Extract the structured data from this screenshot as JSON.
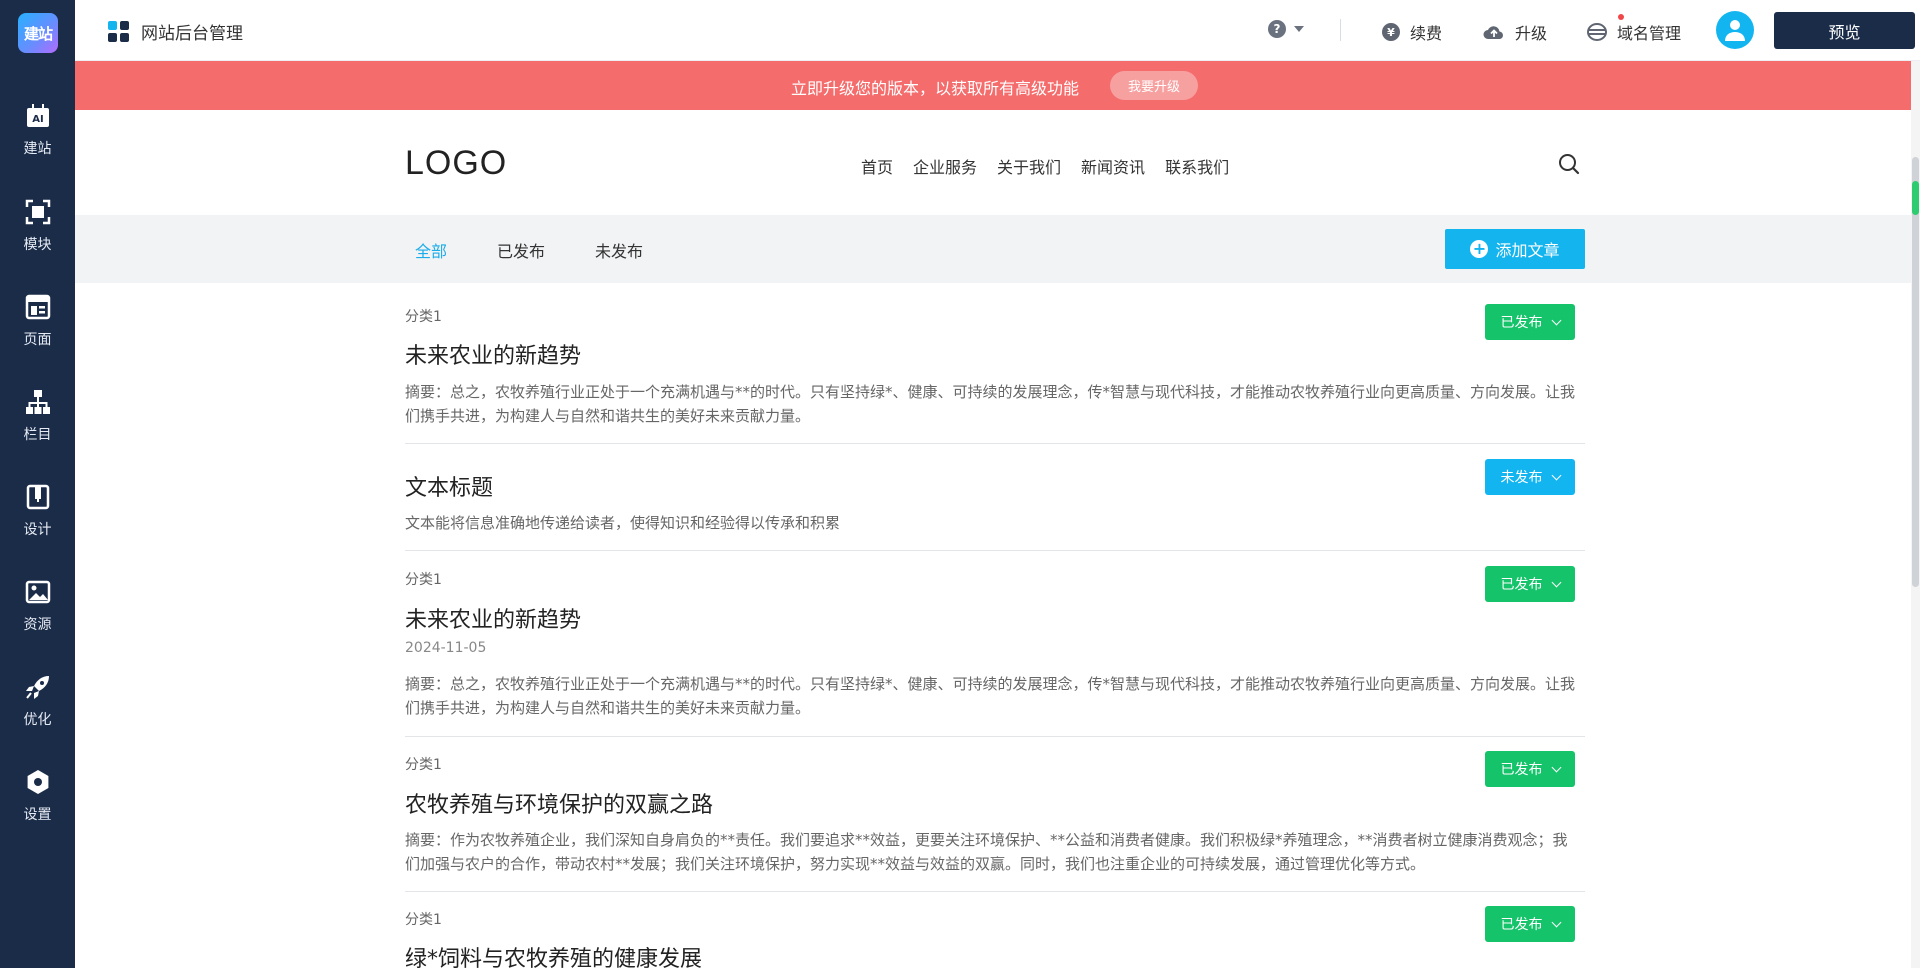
{
  "sidebar": {
    "logo_text": "建站",
    "items": [
      {
        "label": "建站",
        "icon": "ai-build-icon"
      },
      {
        "label": "模块",
        "icon": "module-icon"
      },
      {
        "label": "页面",
        "icon": "page-icon"
      },
      {
        "label": "栏目",
        "icon": "sitemap-icon"
      },
      {
        "label": "设计",
        "icon": "design-icon"
      },
      {
        "label": "资源",
        "icon": "image-resource-icon"
      },
      {
        "label": "优化",
        "icon": "rocket-icon"
      },
      {
        "label": "设置",
        "icon": "settings-icon"
      }
    ]
  },
  "header": {
    "app_title": "网站后台管理",
    "help_label": "?",
    "links": {
      "renew": "续费",
      "upgrade": "升级",
      "domain": "域名管理"
    },
    "preview": "预览"
  },
  "banner": {
    "text": "立即升级您的版本，以获取所有高级功能",
    "button": "我要升级"
  },
  "site": {
    "logo": "LOGO",
    "nav": [
      "首页",
      "企业服务",
      "关于我们",
      "新闻资讯",
      "联系我们"
    ]
  },
  "filter": {
    "tabs": [
      "全部",
      "已发布",
      "未发布"
    ],
    "active_tab": "全部",
    "add_button": "添加文章"
  },
  "articles": [
    {
      "category": "分类1",
      "title": "未来农业的新趋势",
      "date": "",
      "summary": "摘要：总之，农牧养殖行业正处于一个充满机遇与**的时代。只有坚持绿*、健康、可持续的发展理念，传*智慧与现代科技，才能推动农牧养殖行业向更高质量、方向发展。让我们携手共进，为构建人与自然和谐共生的美好未来贡献力量。",
      "status": "已发布"
    },
    {
      "category": "",
      "title": "文本标题",
      "date": "",
      "summary": "文本能将信息准确地传递给读者，使得知识和经验得以传承和积累",
      "status": "未发布"
    },
    {
      "category": "分类1",
      "title": "未来农业的新趋势",
      "date": "2024-11-05",
      "summary": "摘要：总之，农牧养殖行业正处于一个充满机遇与**的时代。只有坚持绿*、健康、可持续的发展理念，传*智慧与现代科技，才能推动农牧养殖行业向更高质量、方向发展。让我们携手共进，为构建人与自然和谐共生的美好未来贡献力量。",
      "status": "已发布"
    },
    {
      "category": "分类1",
      "title": "农牧养殖与环境保护的双赢之路",
      "date": "",
      "summary": "摘要：作为农牧养殖企业，我们深知自身肩负的**责任。我们要追求**效益，更要关注环境保护、**公益和消费者健康。我们积极绿*养殖理念，**消费者树立健康消费观念；我们加强与农户的合作，带动农村**发展；我们关注环境保护，努力实现**效益与效益的双赢。同时，我们也注重企业的可持续发展，通过管理优化等方式。",
      "status": "已发布"
    },
    {
      "category": "分类1",
      "title": "绿*饲料与农牧养殖的健康发展",
      "date": "",
      "summary": "",
      "status": "已发布"
    }
  ],
  "colors": {
    "sidebar_bg": "#1b2c49",
    "banner_bg": "#f56c6c",
    "accent_blue": "#14b5ef",
    "published_green": "#15c46a"
  }
}
